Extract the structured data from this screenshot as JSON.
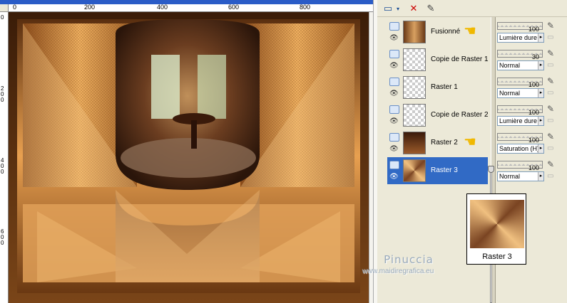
{
  "ruler": {
    "h_ticks": [
      "0",
      "200",
      "400",
      "600",
      "800"
    ],
    "v_ticks": [
      "0",
      "2\n0\n0",
      "4\n0\n0",
      "6\n0\n0"
    ]
  },
  "toolbar": {
    "new_layer_icon": "new-layer-icon",
    "delete_icon": "delete-layer-icon",
    "edit_icon": "edit-selection-icon"
  },
  "layers": [
    {
      "name": "Fusionné",
      "opacity": "100",
      "blend": "Lumière dure",
      "hand": true,
      "thumb": "photo",
      "selected": false
    },
    {
      "name": "Copie de Raster 1",
      "opacity": "30",
      "blend": "Normal",
      "hand": false,
      "thumb": "transparent",
      "selected": false
    },
    {
      "name": "Raster 1",
      "opacity": "100",
      "blend": "Normal",
      "hand": false,
      "thumb": "transparent",
      "selected": false
    },
    {
      "name": "Copie de Raster 2",
      "opacity": "100",
      "blend": "Lumière dure",
      "hand": false,
      "thumb": "transparent",
      "selected": false
    },
    {
      "name": "Raster 2",
      "opacity": "100",
      "blend": "Saturation (H)",
      "hand": true,
      "thumb": "brown",
      "selected": false
    },
    {
      "name": "Raster 3",
      "opacity": "100",
      "blend": "Normal",
      "hand": false,
      "thumb": "gradient",
      "selected": true
    }
  ],
  "tooltip": {
    "label": "Raster 3"
  },
  "watermark": {
    "name": "Pinuccia",
    "url": "www.maidiregrafica.eu"
  },
  "colors": {
    "accent": "#316ac5",
    "panel": "#ece9d8"
  }
}
